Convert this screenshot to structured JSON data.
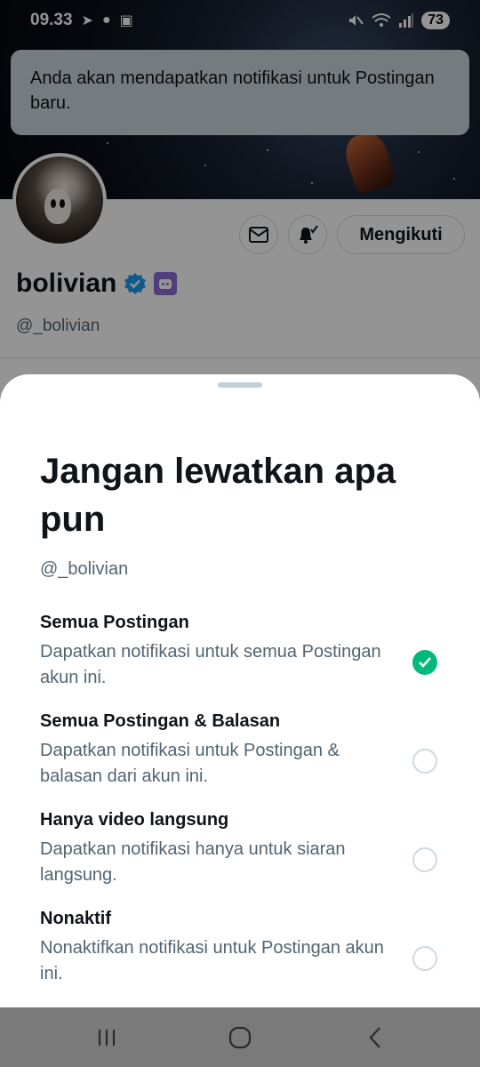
{
  "status_bar": {
    "time": "09.33",
    "battery": "73"
  },
  "toast": {
    "message": "Anda akan mendapatkan notifikasi untuk Postingan baru."
  },
  "profile": {
    "display_name": "bolivian",
    "handle": "@_bolivian",
    "follow_button_label": "Mengikuti"
  },
  "sheet": {
    "title": "Jangan lewatkan apa pun",
    "handle": "@_bolivian",
    "options": [
      {
        "title": "Semua Postingan",
        "description": "Dapatkan notifikasi untuk semua Postingan akun ini.",
        "selected": true
      },
      {
        "title": "Semua Postingan & Balasan",
        "description": "Dapatkan notifikasi untuk Postingan & balasan dari akun ini.",
        "selected": false
      },
      {
        "title": "Hanya video langsung",
        "description": "Dapatkan notifikasi hanya untuk siaran langsung.",
        "selected": false
      },
      {
        "title": "Nonaktif",
        "description": "Nonaktifkan notifikasi untuk Postingan akun ini.",
        "selected": false
      }
    ]
  },
  "colors": {
    "accent_selected": "#00ba7c",
    "verified_blue": "#1d9bf0",
    "toast_bg": "#c9d6db"
  }
}
